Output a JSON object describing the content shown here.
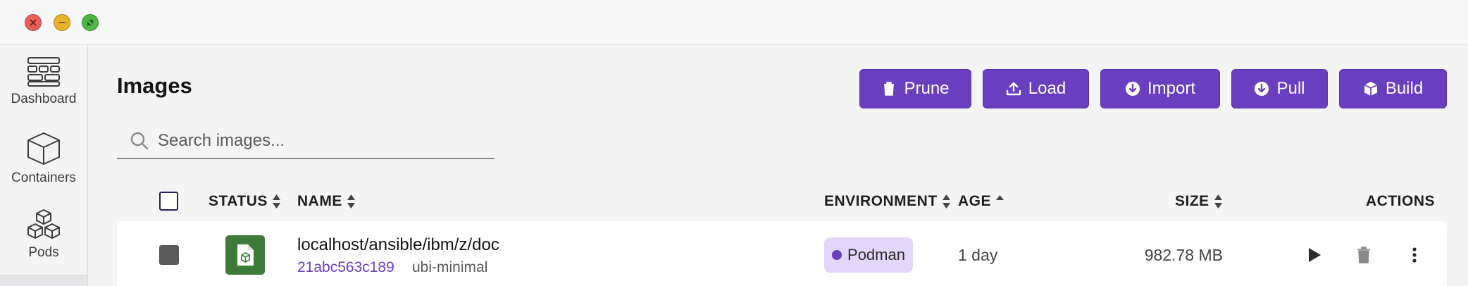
{
  "sidebar": {
    "items": [
      {
        "label": "Dashboard",
        "icon": "dashboard-icon"
      },
      {
        "label": "Containers",
        "icon": "container-icon"
      },
      {
        "label": "Pods",
        "icon": "pods-icon"
      }
    ]
  },
  "page": {
    "title": "Images"
  },
  "toolbar": {
    "prune_label": "Prune",
    "load_label": "Load",
    "import_label": "Import",
    "pull_label": "Pull",
    "build_label": "Build"
  },
  "search": {
    "placeholder": "Search images...",
    "value": ""
  },
  "table": {
    "headers": {
      "status": "STATUS",
      "name": "NAME",
      "environment": "ENVIRONMENT",
      "age": "AGE",
      "size": "SIZE",
      "actions": "ACTIONS"
    },
    "rows": [
      {
        "name": "localhost/ansible/ibm/z/doc",
        "id": "21abc563c189",
        "tag": "ubi-minimal",
        "environment": "Podman",
        "age": "1 day",
        "size": "982.78 MB"
      }
    ]
  },
  "colors": {
    "accent": "#6a3fbf",
    "status_green": "#3e7a3a",
    "badge_bg": "#e2d6fb"
  }
}
